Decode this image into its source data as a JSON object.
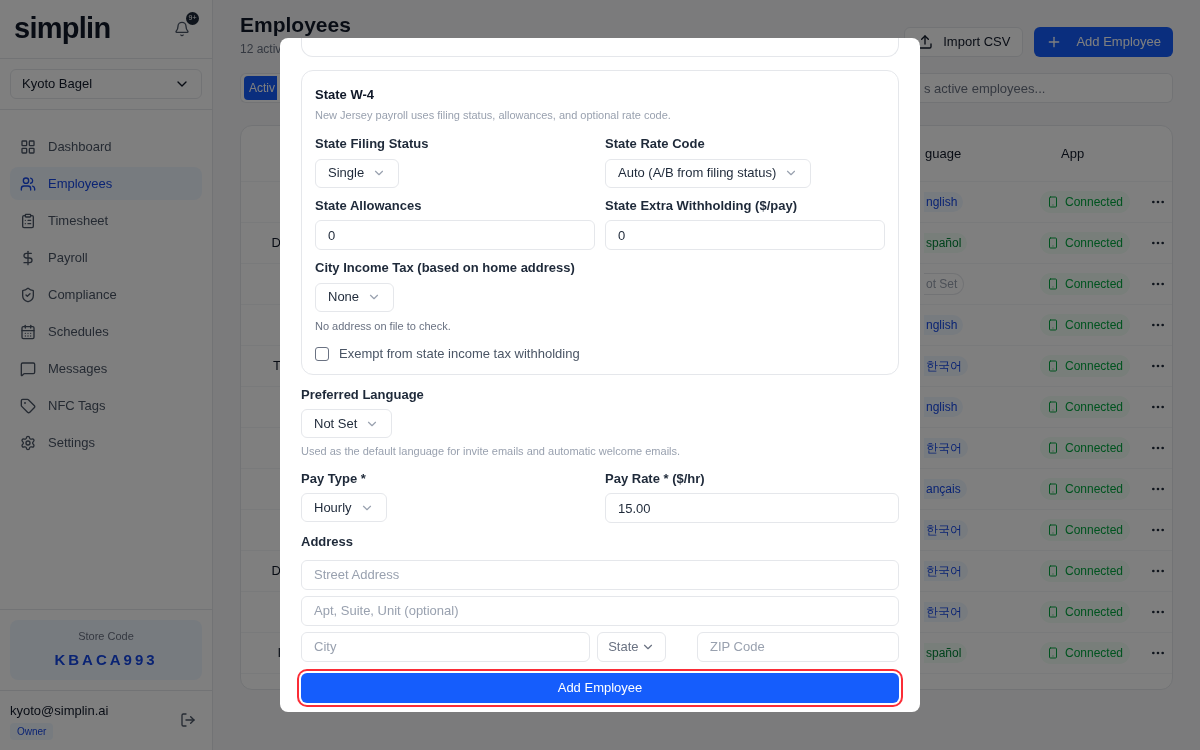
{
  "sidebar": {
    "logo": "simplin",
    "notification_count": "9+",
    "store": "Kyoto Bagel",
    "nav": [
      {
        "label": "Dashboard",
        "selected": false
      },
      {
        "label": "Employees",
        "selected": true
      },
      {
        "label": "Timesheet",
        "selected": false
      },
      {
        "label": "Payroll",
        "selected": false
      },
      {
        "label": "Compliance",
        "selected": false
      },
      {
        "label": "Schedules",
        "selected": false
      },
      {
        "label": "Messages",
        "selected": false
      },
      {
        "label": "NFC Tags",
        "selected": false
      },
      {
        "label": "Settings",
        "selected": false
      }
    ],
    "store_code": {
      "label": "Store Code",
      "value": "KBACA993"
    },
    "user": {
      "email": "kyoto@simplin.ai",
      "role": "Owner"
    }
  },
  "main": {
    "title": "Employees",
    "subtitle": "12 activ",
    "import_button": "Import CSV",
    "add_button": "Add Employee",
    "tab": {
      "label": "Activ",
      "selected": true
    },
    "search": {
      "placeholder": "s active employees..."
    },
    "table": {
      "columns": [
        "guage",
        "App"
      ],
      "rows": [
        {
          "column_1": "",
          "language": "nglish",
          "kind": "primary",
          "app": "Connected"
        },
        {
          "column_1": "D",
          "language": "spañol",
          "kind": "success",
          "app": "Connected"
        },
        {
          "column_1": "",
          "language": "ot Set",
          "kind": "muted",
          "app": "Connected"
        },
        {
          "column_1": "",
          "language": "nglish",
          "kind": "primary",
          "app": "Connected"
        },
        {
          "column_1": "T",
          "language": "한국어",
          "kind": "primary",
          "app": "Connected"
        },
        {
          "column_1": "",
          "language": "nglish",
          "kind": "primary",
          "app": "Connected"
        },
        {
          "column_1": "",
          "language": "한국어",
          "kind": "primary",
          "app": "Connected"
        },
        {
          "column_1": "",
          "language": "ançais",
          "kind": "primary",
          "app": "Connected"
        },
        {
          "column_1": "",
          "language": "한국어",
          "kind": "primary",
          "app": "Connected"
        },
        {
          "column_1": "D",
          "language": "한국어",
          "kind": "primary",
          "app": "Connected"
        },
        {
          "column_1": "",
          "language": "한국어",
          "kind": "primary",
          "app": "Connected"
        },
        {
          "column_1": "I",
          "language": "spañol",
          "kind": "success",
          "app": "Connected"
        }
      ]
    }
  },
  "modal": {
    "state_w4": {
      "title": "State W-4",
      "description": "New Jersey payroll uses filing status, allowances, and optional rate code.",
      "fields": [
        {
          "kind": "select",
          "label": "State Filing Status",
          "value": "Single"
        },
        {
          "kind": "select",
          "label": "State Rate Code",
          "value": "Auto (A/B from filing status)"
        },
        {
          "kind": "input",
          "label": "State Allowances",
          "value": "0"
        },
        {
          "kind": "input",
          "label": "State Extra Withholding ($/pay)",
          "value": "0"
        }
      ],
      "city_tax": {
        "label": "City Income Tax (based on home address)",
        "value": "None",
        "note": "No address on file to check."
      },
      "exempt": {
        "label": "Exempt from state income tax withholding",
        "checked": false
      }
    },
    "preferred_language": {
      "label": "Preferred Language",
      "value": "Not Set",
      "note": "Used as the default language for invite emails and automatic welcome emails."
    },
    "pay_type": {
      "label": "Pay Type *",
      "value": "Hourly"
    },
    "pay_rate": {
      "label": "Pay Rate * ($/hr)",
      "value": "15.00"
    },
    "address": {
      "label": "Address",
      "street": {
        "placeholder": "Street Address"
      },
      "apt": {
        "placeholder": "Apt, Suite, Unit (optional)"
      },
      "city": {
        "placeholder": "City"
      },
      "state": {
        "value": "State"
      },
      "zip": {
        "placeholder": "ZIP Code"
      }
    },
    "submit": {
      "label": "Add Employee",
      "focused": true
    }
  }
}
